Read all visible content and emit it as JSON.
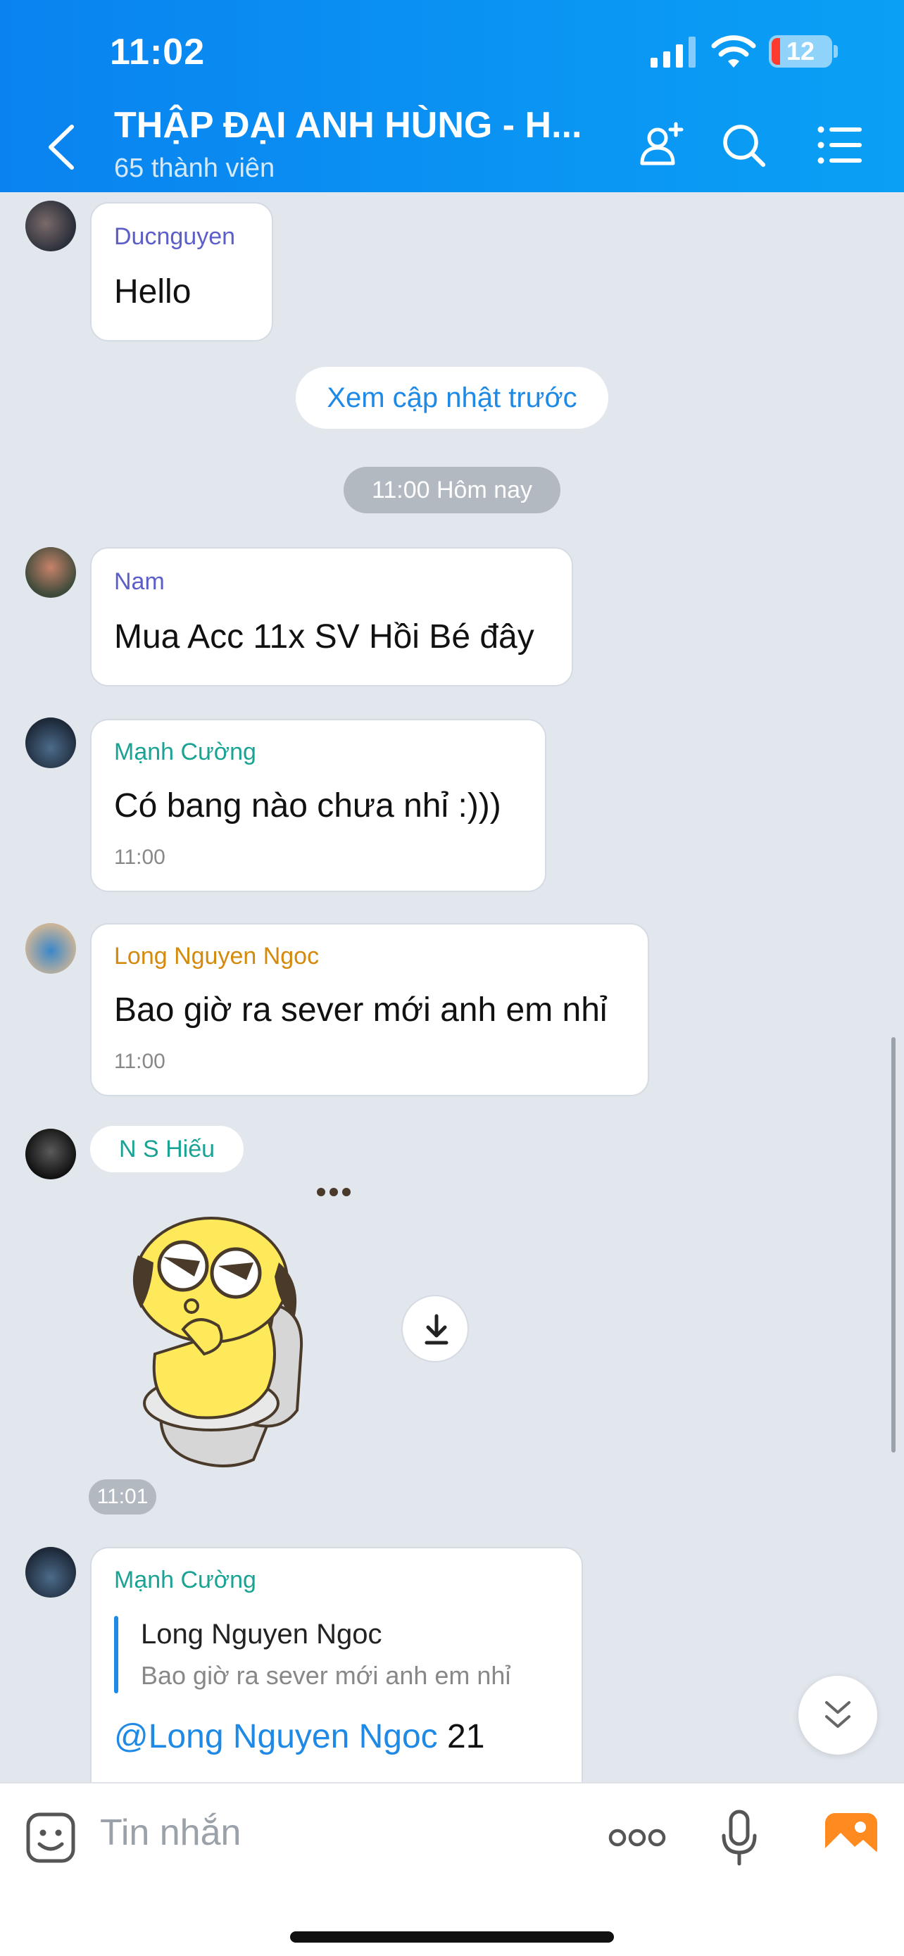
{
  "status_bar": {
    "time": "11:02",
    "battery": "12"
  },
  "header": {
    "title": "THẬP ĐẠI ANH HÙNG - H...",
    "subtitle": "65 thành viên"
  },
  "messages": {
    "m1": {
      "sender": "Ducnguyen",
      "text": "Hello"
    },
    "load_previous": "Xem cập nhật trước",
    "date_divider": "11:00 Hôm nay",
    "m2": {
      "sender": "Nam",
      "text": "Mua Acc 11x SV Hồi Bé đây"
    },
    "m3": {
      "sender": "Mạnh Cường",
      "text": "Có bang nào chưa nhỉ :)))",
      "time": "11:00"
    },
    "m4": {
      "sender": "Long Nguyen Ngoc",
      "text": "Bao giờ ra sever mới anh em nhỉ",
      "time": "11:00"
    },
    "m5": {
      "sender": "N S Hiếu",
      "time": "11:01"
    },
    "m6": {
      "sender": "Mạnh Cường",
      "quote_author": "Long Nguyen Ngoc",
      "quote_text": "Bao giờ ra sever mới anh em nhỉ",
      "mention": "@Long Nguyen Ngoc",
      "text": " 21"
    }
  },
  "input": {
    "placeholder": "Tin nhắn"
  },
  "colors": {
    "header": "#0a8ff2",
    "sender_purple": "#5b5fc7",
    "sender_teal": "#1aa394",
    "sender_orange": "#d48a0c",
    "link_blue": "#1f8ae6"
  }
}
